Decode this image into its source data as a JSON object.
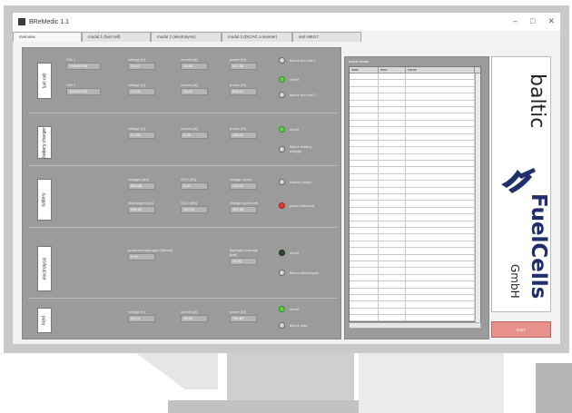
{
  "window": {
    "title": "BReMedic 1.1",
    "minimize": "–",
    "maximize": "□",
    "close": "✕"
  },
  "tabs": [
    {
      "label": "overview"
    },
    {
      "label": "modul 1 (fuel cell)"
    },
    {
      "label": "modul 2 (electrolysis)"
    },
    {
      "label": "modul 3 (DC/AC converter)"
    },
    {
      "label": "test HMI17"
    }
  ],
  "fuel_cell": {
    "label": "fuel cell",
    "sn1": {
      "label": "S/N 1",
      "value": "100269759"
    },
    "sn2": {
      "label": "S/N 2",
      "value": "100269759"
    },
    "row1": {
      "voltage_label": "voltage [V]",
      "voltage": "26,41",
      "current_label": "current [A]",
      "current": "18,90",
      "power_label": "power [W]",
      "power": "511,39"
    },
    "row2": {
      "voltage_label": "voltage [V]",
      "voltage": "26,23",
      "current_label": "current [A]",
      "current": "18,00",
      "power_label": "power [W]",
      "power": "508,14"
    },
    "ind_failure1": "failure fuel cell 1",
    "ind_onoff": "on/off",
    "ind_failure2": "failure fuel cell 2"
  },
  "charger": {
    "label": "battery charger",
    "voltage_label": "voltage [V]",
    "voltage": "27,30",
    "current_label": "current [A]",
    "current": "6,16",
    "power_label": "power [W]",
    "power": "168,34",
    "ind_onoff": "on/off",
    "ind_failure": "failure battery charger"
  },
  "battery": {
    "label": "battery",
    "charged_label": "charged [Ah]",
    "charged": "560,48",
    "soc_ah_label": "SOC [Ah]",
    "soc_ah": "4,20",
    "cycles_label": "charge cycles",
    "cycles": "112,00",
    "discharged_label": "discharged [Ah]",
    "discharged": "556,64",
    "soc_wh_label": "SOC [Wh]",
    "soc_wh": "100,00",
    "cycles_left_label": "charge cycles left",
    "cycles_left": "187,00",
    "ind_empty": "battery empty",
    "ind_blackout": "power blackout"
  },
  "electrolysis": {
    "label": "electrolysis",
    "h2_label": "produced hydrogen [Nl/min]",
    "h2": "0,00",
    "storage_label": "hydrogen storage [bar]",
    "storage": "15,40",
    "ind_onoff": "on/off",
    "ind_failure": "failure electrolysis"
  },
  "load": {
    "label": "load",
    "voltage_label": "voltage [V]",
    "voltage": "48,10",
    "current_label": "current [A]",
    "current": "15,69",
    "power_label": "power [W]",
    "power": "754,69",
    "ind_onoff": "on/off",
    "ind_failure": "failure load"
  },
  "event_viewer": {
    "title": "event viewer",
    "columns": [
      "date",
      "time",
      "name"
    ],
    "row_count": 37
  },
  "logo": {
    "line1": "baltic",
    "line2": "FuelCells",
    "line3": "GmbH"
  },
  "exit_button": {
    "label": "EXIT"
  },
  "colors": {
    "panel": "#9b9b9b",
    "led_green": "#5ed14a",
    "led_red": "#e53b2b",
    "exit": "#e8908a",
    "logo_blue": "#1f2f6b"
  }
}
